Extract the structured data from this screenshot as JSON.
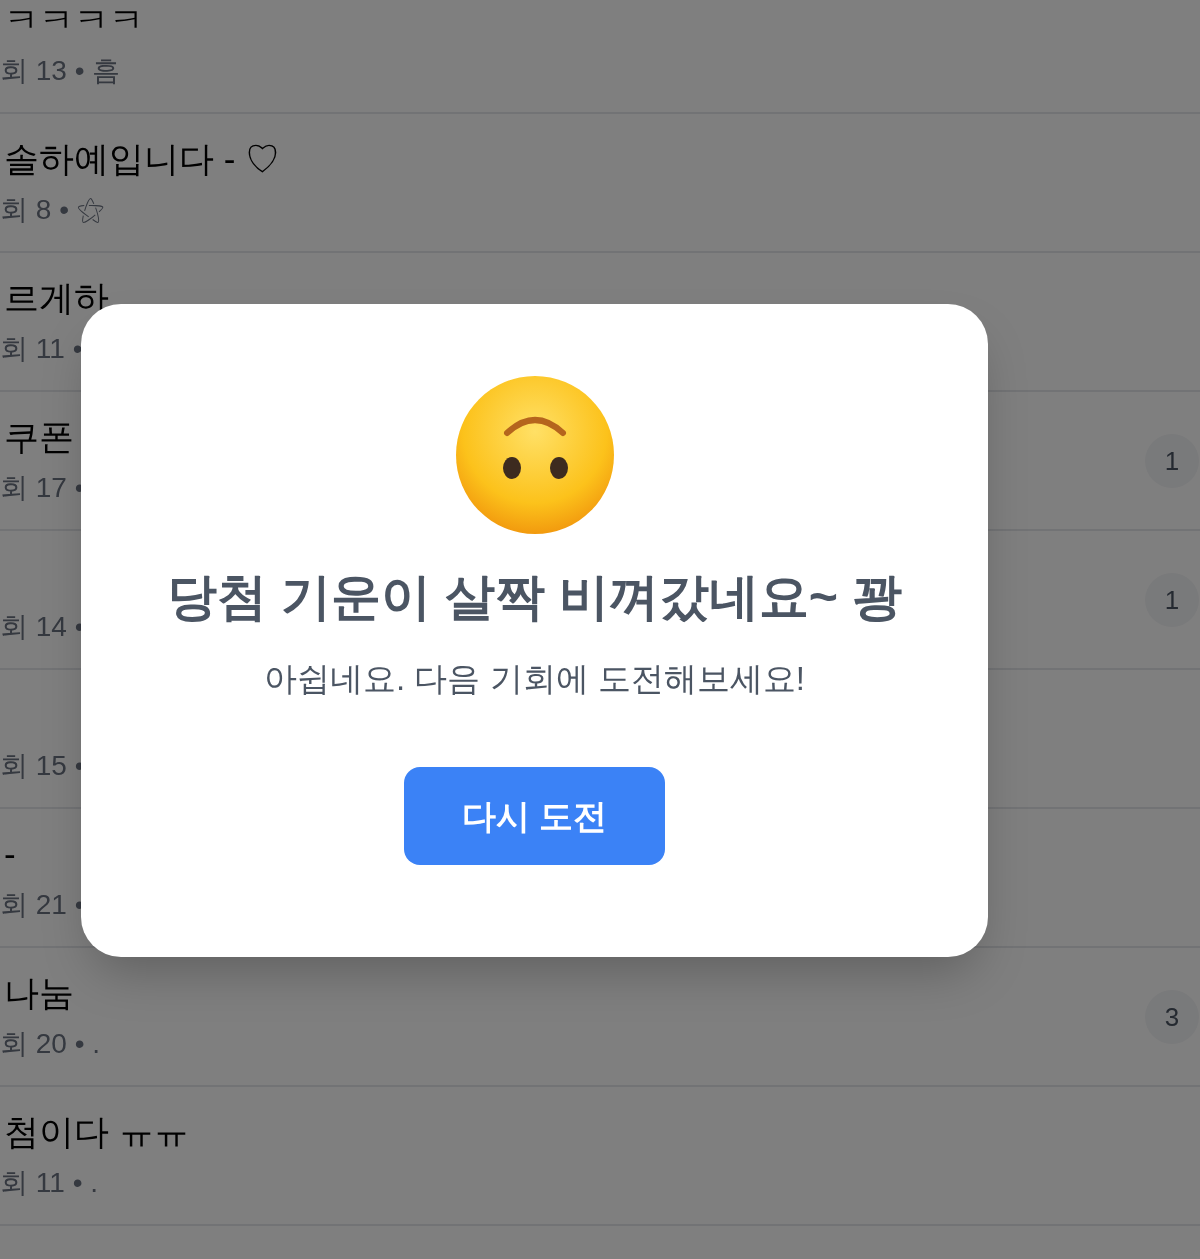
{
  "list": {
    "items": [
      {
        "title": "ㅋㅋㅋㅋ",
        "meta": "회 13 • 흠"
      },
      {
        "title": "솔하예입니다 - ♡",
        "meta": "회 8 • ⚝"
      },
      {
        "title": "르게하",
        "meta": "회 11 •"
      },
      {
        "title": "쿠폰",
        "meta": "회 17 •",
        "badge": "1"
      },
      {
        "meta": "회 14 •",
        "badge": "1"
      },
      {
        "meta": "회 15 •"
      },
      {
        "title": "-",
        "meta": "회 21 •"
      },
      {
        "title": "나눔",
        "meta": "회 20 • .",
        "badge": "3"
      },
      {
        "title": "첨이다 ㅠㅠ",
        "meta": "회 11 • ."
      }
    ]
  },
  "dialog": {
    "title": "당첨 기운이 살짝 비껴갔네요~ 꽝",
    "message": "아쉽네요. 다음 기회에 도전해보세요!",
    "button": "다시 도전"
  }
}
